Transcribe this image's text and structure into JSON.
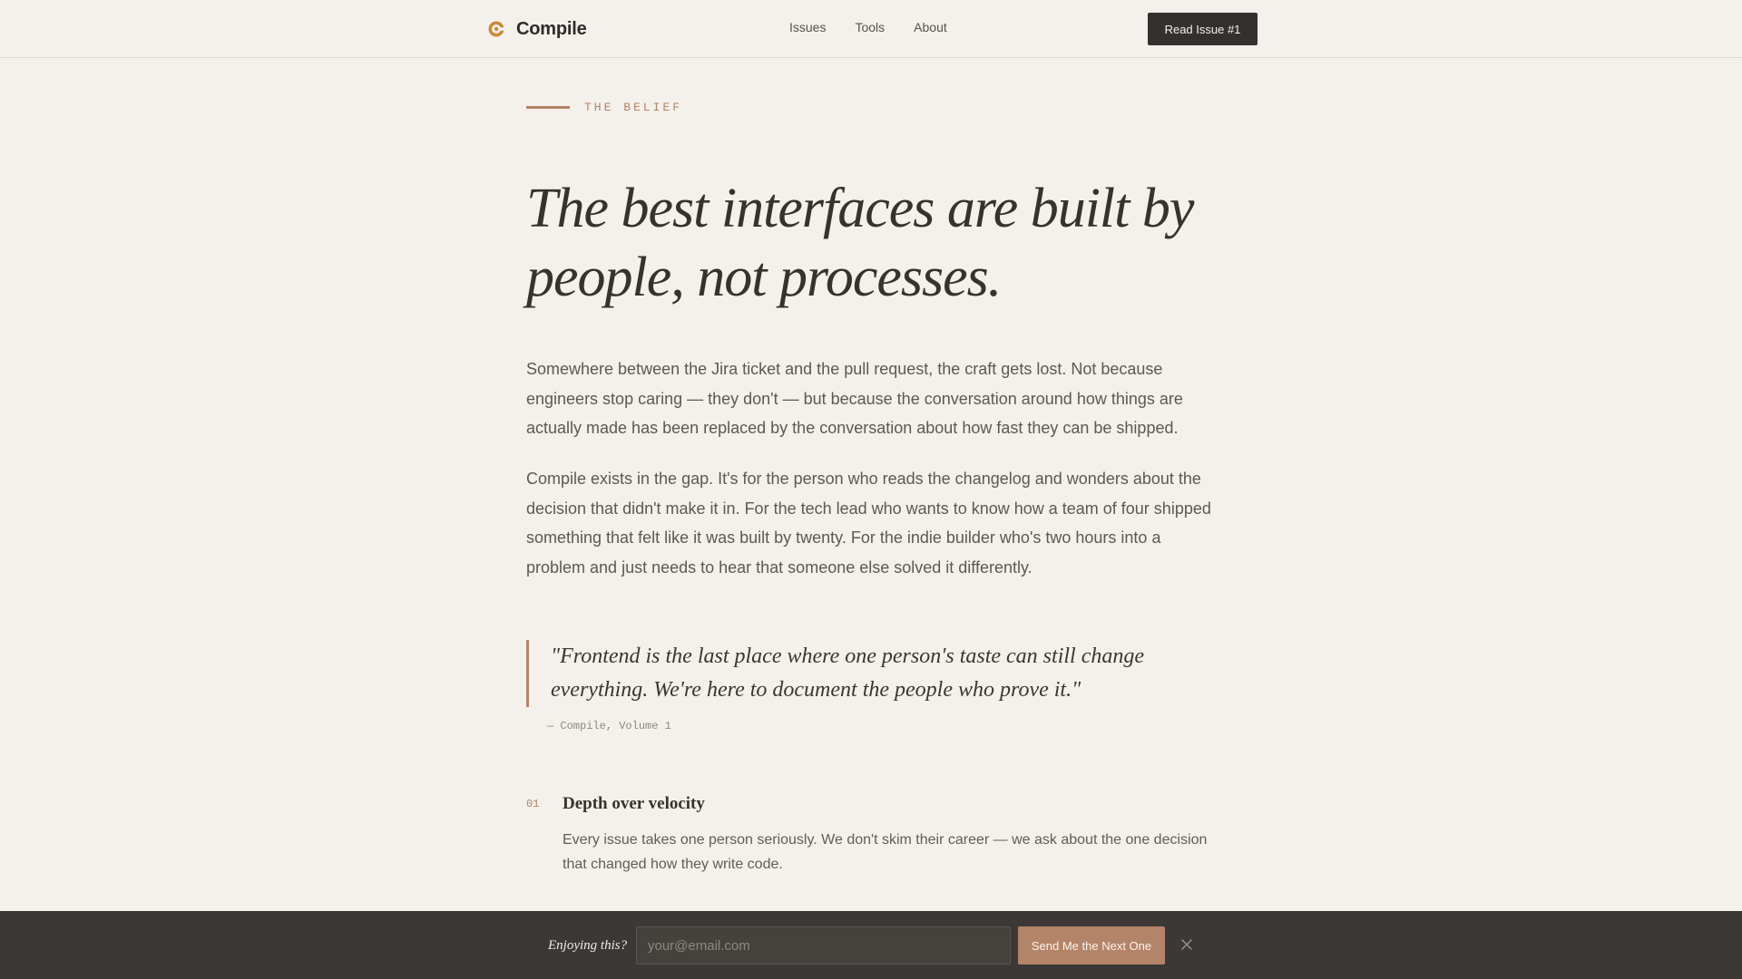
{
  "header": {
    "brand": "Compile",
    "nav": [
      "Issues",
      "Tools",
      "About"
    ],
    "cta_label": "Read Issue #1"
  },
  "main": {
    "eyebrow": "THE BELIEF",
    "headline": "The best interfaces are built by people, not processes.",
    "paragraphs": [
      "Somewhere between the Jira ticket and the pull request, the craft gets lost. Not because engineers stop caring — they don't — but because the conversation around how things are actually made has been replaced by the conversation about how fast they can be shipped.",
      "Compile exists in the gap. It's for the person who reads the changelog and wonders about the decision that didn't make it in. For the tech lead who wants to know how a team of four shipped something that felt like it was built by twenty. For the indie builder who's two hours into a problem and just needs to hear that someone else solved it differently."
    ],
    "quote": {
      "text": "\"Frontend is the last place where one person's taste can still change everything. We're here to document the people who prove it.\"",
      "cite": "— Compile, Volume 1"
    },
    "principles": [
      {
        "number": "01",
        "title": "Depth over velocity",
        "body": "Every issue takes one person seriously. We don't skim their career — we ask about the one decision that changed how they write code."
      }
    ]
  },
  "subscribe_bar": {
    "label": "Enjoying this?",
    "email_placeholder": "your@email.com",
    "button_label": "Send Me the Next One"
  },
  "colors": {
    "background": "#f4f0eb",
    "accent": "#b48468",
    "dark": "#33302d",
    "bar": "#3b3835"
  },
  "icons": {
    "brand": "compile-logo-icon",
    "dismiss": "close-icon"
  }
}
